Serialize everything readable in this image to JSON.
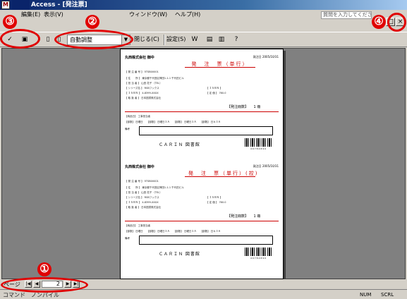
{
  "window": {
    "title": "Access - [発注票]",
    "app_icon_letter": "M",
    "min_label": "_",
    "max_label": "□",
    "close_label": "×"
  },
  "menu": {
    "items": [
      "編集(E)",
      "表示(V)",
      "ウィンドウ(W)",
      "ヘルプ(H)"
    ],
    "help_placeholder": "質問を入力してください"
  },
  "toolbar": {
    "zoom_value": "自動調整",
    "close_label": "閉じる(C)",
    "setup_label": "設定(S)",
    "icons": [
      "print-icon",
      "open-icon",
      "zoom-icon",
      "view-icon",
      "word-icon",
      "db-window-icon",
      "new-object-icon",
      "help-icon"
    ]
  },
  "callouts": [
    "①",
    "②",
    "③",
    "④"
  ],
  "document": {
    "forms": [
      {
        "company": "丸西株式会社 御中",
        "date_label": "発注日",
        "date": "2005/10/31",
        "title": "発　注　票（単行）",
        "rows_left": [
          "【 発 注 番 号 】 5TSB00001",
          "【 住　　所 】 東京都千代田区神田1-1-1 千代田ビル",
          "【 担 当 者 】 山田 花子 （TEL）",
          "【 シリーズ名 】 RSBフックス",
          "【 ＩＳＢＮ 】 4-8399-XXXX",
          "【 取 扱 者 】 日本図書株式会社"
        ],
        "rows_right": [
          "【 ＩＳＢＮ 】",
          "【 定 価 】 760.0"
        ],
        "amount_label": "【発注冊数】",
        "amount": "1 冊",
        "cells_top": "【納品日】 工事担当者",
        "cells_mid": "【部数】 日曜日　　【部数】 日曜日３Ａ　　【部数】 日曜日３Ａ　　【部数】 日々３Ａ",
        "remarks_label": "備考",
        "brand": "ＣＡＲＩＮ 図書館",
        "barcode_number": "4  9 7 8 4 8 9 0"
      },
      {
        "company": "丸西株式会社 御中",
        "date_label": "発注日",
        "date": "2005/10/31",
        "title": "発　注　票（単行）(控)",
        "rows_left": [
          "【 発 注 番 号 】 5TSB00001",
          "【 住　　所 】 東京都千代田区神田1-1-1 千代田ビル",
          "【 担 当 者 】 山田 花子 （TEL）",
          "【 シリーズ名 】 RSBフックス",
          "【 ＩＳＢＮ 】 4-8399-XXXX",
          "【 取 扱 者 】 日本図書株式会社"
        ],
        "rows_right": [
          "【 ＩＳＢＮ 】",
          "【 定 価 】 760.0"
        ],
        "amount_label": "【発注冊数】",
        "amount": "1 冊",
        "cells_top": "【納品日】 工事担当者",
        "cells_mid": "【部数】 日曜日　　【部数】 日曜日３Ａ　　【部数】 日曜日３Ａ　　【部数】 日々３Ａ",
        "remarks_label": "備考",
        "brand": "ＣＡＲＩＮ 図書館",
        "barcode_number": "4  9 7 8 4 8 9 0"
      }
    ]
  },
  "navigation": {
    "label": "ページ",
    "page": "2",
    "first": "|◀",
    "prev": "◀",
    "next": "▶",
    "last": "▶|"
  },
  "status": {
    "text": "コマンド　ノンパイル",
    "num": "NUM",
    "scrl": "SCRL"
  }
}
